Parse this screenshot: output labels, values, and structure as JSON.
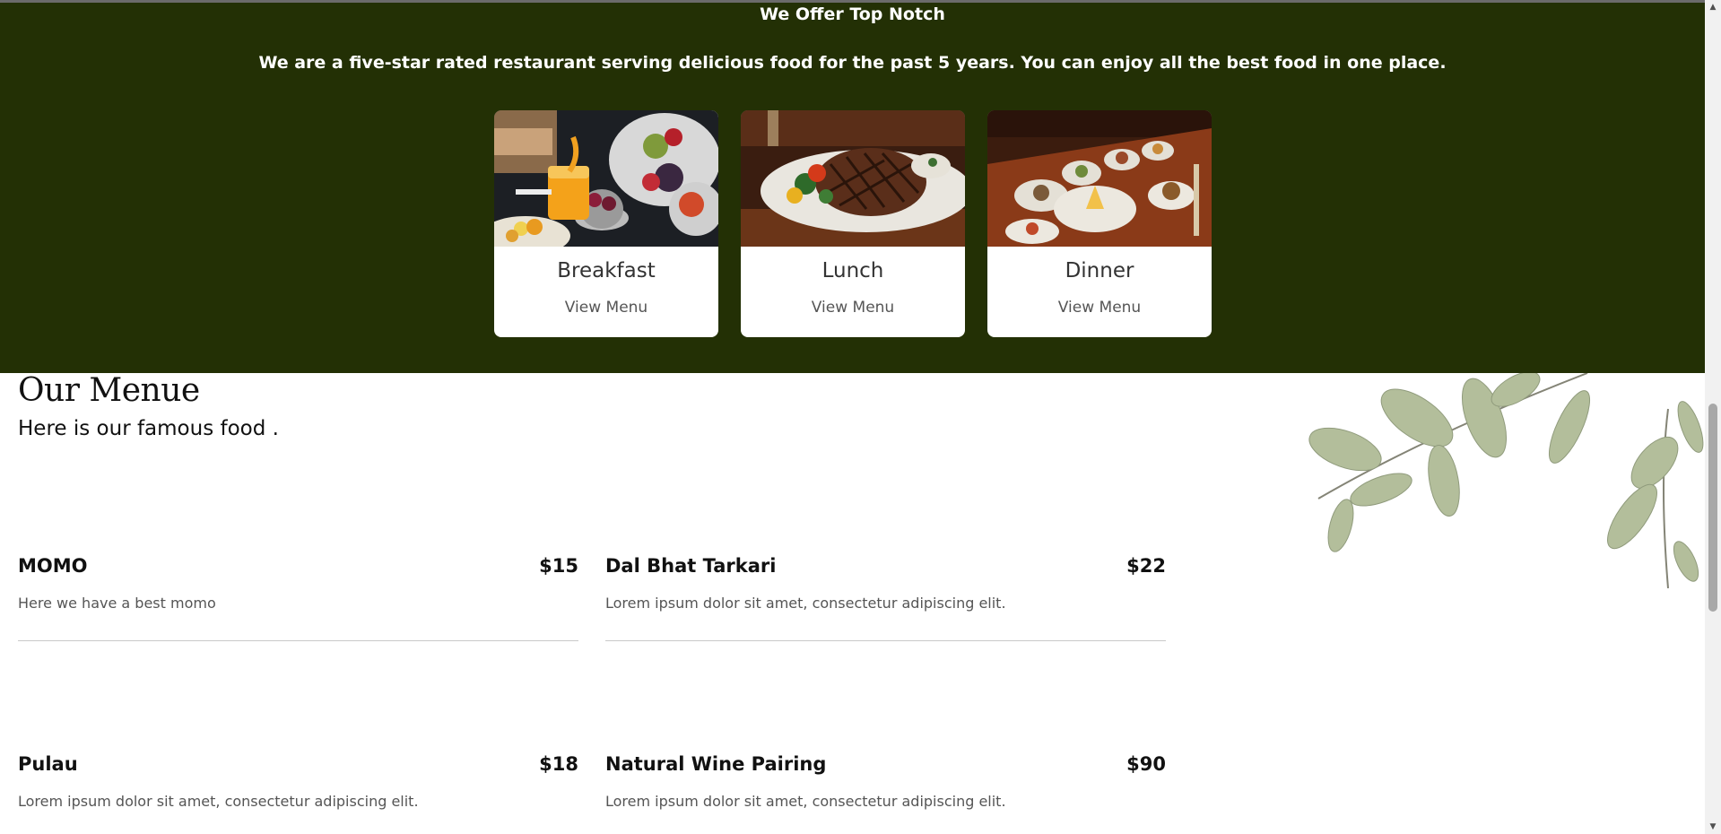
{
  "offer": {
    "title": "We Offer Top Notch",
    "subtitle": "We are a five-star rated restaurant serving delicious food for the past 5 years. You can enjoy all the best food in one place.",
    "cards": [
      {
        "name": "Breakfast",
        "link": "View Menu"
      },
      {
        "name": "Lunch",
        "link": "View Menu"
      },
      {
        "name": "Dinner",
        "link": "View Menu"
      }
    ]
  },
  "menu": {
    "title": "Our Menue",
    "subtitle": "Here is our famous food .",
    "items": [
      {
        "name": "MOMO",
        "price": "$15",
        "description": "Here we have a best momo"
      },
      {
        "name": "Dal Bhat Tarkari",
        "price": "$22",
        "description": "Lorem ipsum dolor sit amet, consectetur adipiscing elit."
      },
      {
        "name": "Pulau",
        "price": "$18",
        "description": "Lorem ipsum dolor sit amet, consectetur adipiscing elit."
      },
      {
        "name": "Natural Wine Pairing",
        "price": "$90",
        "description": "Lorem ipsum dolor sit amet, consectetur adipiscing elit."
      }
    ]
  },
  "colors": {
    "offer_background": "#233005",
    "card_background": "#ffffff",
    "divider": "#c9c9c9"
  }
}
